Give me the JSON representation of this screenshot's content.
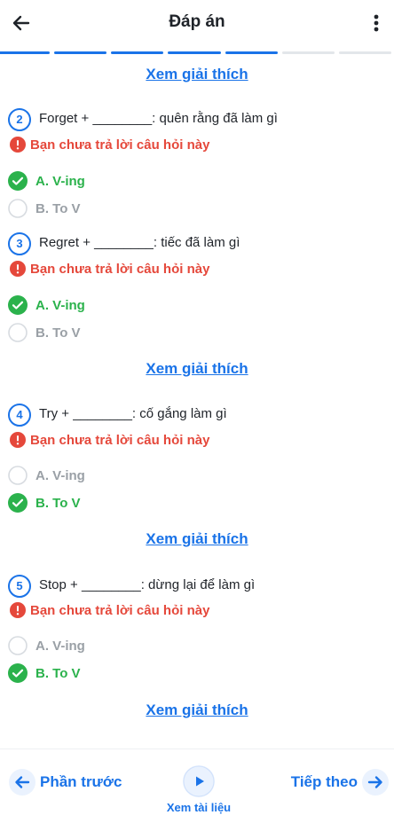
{
  "header": {
    "title": "Đáp án"
  },
  "progress": {
    "segments_total": 7,
    "segments_done": 5
  },
  "colors": {
    "accent": "#1a73e8",
    "correct": "#2bb24c",
    "error": "#e5483b",
    "muted": "#9aa0a6"
  },
  "explain_label": "Xem giải thích",
  "unanswered_label": "Bạn chưa trả lời câu hỏi này",
  "questions": [
    {
      "number": "2",
      "text": "Forget + ________: quên rằng đã làm gì",
      "options": [
        {
          "label": "A. V-ing",
          "state": "correct"
        },
        {
          "label": "B. To V",
          "state": "unselected"
        }
      ]
    },
    {
      "number": "3",
      "text": "Regret + ________: tiếc đã làm gì",
      "options": [
        {
          "label": "A. V-ing",
          "state": "correct"
        },
        {
          "label": "B. To V",
          "state": "unselected"
        }
      ]
    },
    {
      "number": "4",
      "text": "Try + ________: cố gắng làm gì",
      "options": [
        {
          "label": "A. V-ing",
          "state": "unselected"
        },
        {
          "label": "B. To V",
          "state": "correct"
        }
      ]
    },
    {
      "number": "5",
      "text": "Stop + ________: dừng lại để làm gì",
      "options": [
        {
          "label": "A. V-ing",
          "state": "unselected"
        },
        {
          "label": "B. To V",
          "state": "correct"
        }
      ]
    }
  ],
  "footer": {
    "prev_label": "Phần trước",
    "docs_label": "Xem tài liệu",
    "next_label": "Tiếp theo"
  }
}
